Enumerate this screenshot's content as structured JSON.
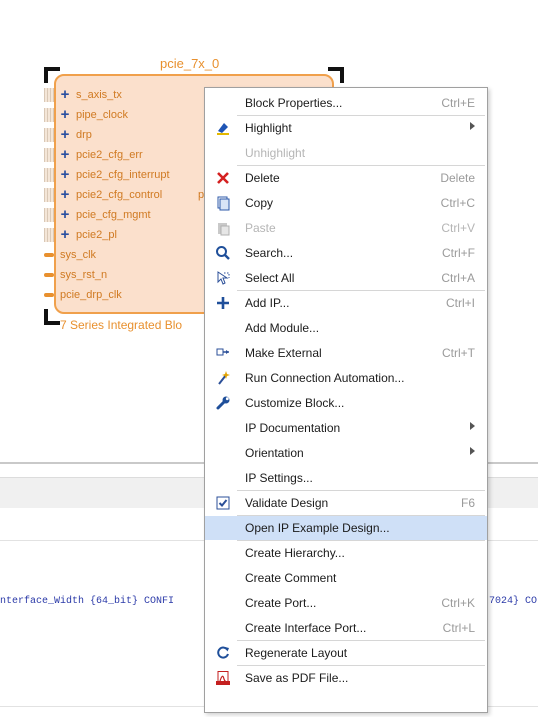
{
  "block": {
    "title": "pcie_7x_0",
    "subtitle": "7 Series Integrated Blo",
    "right_label": "p",
    "ports": [
      {
        "name": "s_axis_tx",
        "kind": "bus"
      },
      {
        "name": "pipe_clock",
        "kind": "bus"
      },
      {
        "name": "drp",
        "kind": "bus"
      },
      {
        "name": "pcie2_cfg_err",
        "kind": "bus"
      },
      {
        "name": "pcie2_cfg_interrupt",
        "kind": "bus"
      },
      {
        "name": "pcie2_cfg_control",
        "kind": "bus"
      },
      {
        "name": "pcie_cfg_mgmt",
        "kind": "bus"
      },
      {
        "name": "pcie2_pl",
        "kind": "bus"
      },
      {
        "name": "sys_clk",
        "kind": "pin"
      },
      {
        "name": "sys_rst_n",
        "kind": "pin"
      },
      {
        "name": "pcie_drp_clk",
        "kind": "pin"
      }
    ]
  },
  "console": {
    "line_text": "nterface_Width {64_bit} CONFI",
    "line_tail": "7024} CO"
  },
  "menu": {
    "items": [
      {
        "label": "Block Properties...",
        "shortcut": "Ctrl+E",
        "icon": ""
      },
      {
        "label": "Highlight",
        "shortcut": "",
        "icon": "highlight-icon",
        "submenu": true
      },
      {
        "label": "Unhighlight",
        "shortcut": "",
        "icon": "",
        "disabled": true
      },
      {
        "label": "Delete",
        "shortcut": "Delete",
        "icon": "delete-icon"
      },
      {
        "label": "Copy",
        "shortcut": "Ctrl+C",
        "icon": "copy-icon"
      },
      {
        "label": "Paste",
        "shortcut": "Ctrl+V",
        "icon": "paste-icon",
        "disabled": true
      },
      {
        "label": "Search...",
        "shortcut": "Ctrl+F",
        "icon": "search-icon"
      },
      {
        "label": "Select All",
        "shortcut": "Ctrl+A",
        "icon": "select-all-icon"
      },
      {
        "label": "Add IP...",
        "shortcut": "Ctrl+I",
        "icon": "add-icon"
      },
      {
        "label": "Add Module...",
        "shortcut": "",
        "icon": ""
      },
      {
        "label": "Make External",
        "shortcut": "Ctrl+T",
        "icon": "make-external-icon"
      },
      {
        "label": "Run Connection Automation...",
        "shortcut": "",
        "icon": "wand-icon"
      },
      {
        "label": "Customize Block...",
        "shortcut": "",
        "icon": "wrench-icon"
      },
      {
        "label": "IP Documentation",
        "shortcut": "",
        "icon": "",
        "submenu": true
      },
      {
        "label": "Orientation",
        "shortcut": "",
        "icon": "",
        "submenu": true
      },
      {
        "label": "IP Settings...",
        "shortcut": "",
        "icon": ""
      },
      {
        "label": "Validate Design",
        "shortcut": "F6",
        "icon": "validate-icon"
      },
      {
        "label": "Open IP Example Design...",
        "shortcut": "",
        "icon": "",
        "selected": true
      },
      {
        "label": "Create Hierarchy...",
        "shortcut": "",
        "icon": ""
      },
      {
        "label": "Create Comment",
        "shortcut": "",
        "icon": ""
      },
      {
        "label": "Create Port...",
        "shortcut": "Ctrl+K",
        "icon": ""
      },
      {
        "label": "Create Interface Port...",
        "shortcut": "Ctrl+L",
        "icon": ""
      },
      {
        "label": "Regenerate Layout",
        "shortcut": "",
        "icon": "regenerate-icon"
      },
      {
        "label": "Save as PDF File...",
        "shortcut": "",
        "icon": "pdf-icon"
      }
    ]
  }
}
